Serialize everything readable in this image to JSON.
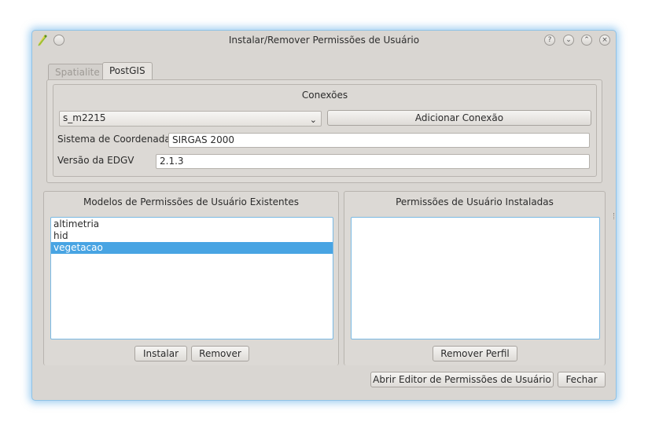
{
  "window": {
    "title": "Instalar/Remover Permissões de Usuário",
    "titlebar_buttons": [
      "?",
      "⌄",
      "⌃",
      "×"
    ]
  },
  "tabs": [
    {
      "label": "Spatialite",
      "active": false
    },
    {
      "label": "PostGIS",
      "active": true
    }
  ],
  "connections": {
    "group_title": "Conexões",
    "selected_connection": "s_m2215",
    "add_button": "Adicionar Conexão",
    "crs_label": "Sistema de Coordenadas",
    "crs_value": "SIRGAS 2000",
    "edgv_label": "Versão da EDGV",
    "edgv_value": "2.1.3"
  },
  "models_panel": {
    "title": "Modelos de Permissões de Usuário Existentes",
    "items": [
      {
        "label": "altimetria",
        "selected": false
      },
      {
        "label": "hid",
        "selected": false
      },
      {
        "label": "vegetacao",
        "selected": true
      }
    ],
    "install_button": "Instalar",
    "remove_button": "Remover"
  },
  "installed_panel": {
    "title": "Permissões de Usuário Instaladas",
    "items": [],
    "remove_profile_button": "Remover Perfil"
  },
  "footer": {
    "open_editor_button": "Abrir Editor de Permissões de Usuário",
    "close_button": "Fechar"
  },
  "colors": {
    "window_bg": "#d9d6d2",
    "selection": "#48a4e3",
    "focus_border": "#79b9e4",
    "qgis_logo": "#8cbd3a"
  }
}
